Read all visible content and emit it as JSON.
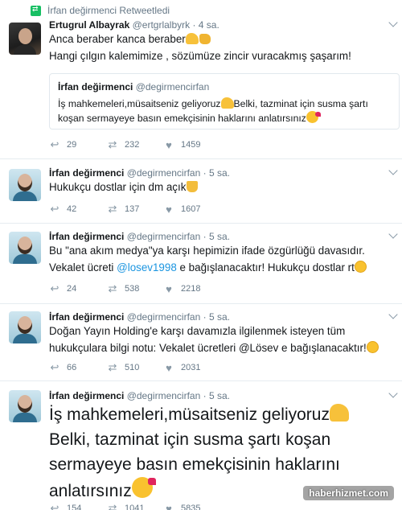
{
  "retweet_banner": {
    "text": "İrfan değirmenci Retweetledi"
  },
  "tweets": [
    {
      "name": "Ertugrul Albayrak",
      "handle": "@ertgrlalbyrk",
      "date": "· 4 sa.",
      "line1": "Anca beraber kanca beraber",
      "line2": "Hangi çılgın kalemimize , sözümüze zincir vuracakmış şaşarım!",
      "quote": {
        "name": "İrfan değirmenci",
        "handle": "@degirmencirfan",
        "text_a": "İş mahkemeleri,müsaitseniz geliyoruz",
        "text_b": "Belki, tazminat için susma şartı",
        "line2": "koşan sermayeye basın emekçisinin haklarını anlatırsınız"
      },
      "replies": "29",
      "retweets": "232",
      "likes": "1459"
    },
    {
      "name": "İrfan değirmenci",
      "handle": "@degirmencirfan",
      "date": "· 5 sa.",
      "line1": "Hukukçu dostlar için dm açık",
      "replies": "42",
      "retweets": "137",
      "likes": "1607"
    },
    {
      "name": "İrfan değirmenci",
      "handle": "@degirmencirfan",
      "date": "· 5 sa.",
      "line1": "Bu \"ana akım medya\"ya karşı hepimizin ifade özgürlüğü davasıdır.",
      "line2_a": "Vekalet ücreti ",
      "line2_link": "@losev1998",
      "line2_b": " e bağışlanacaktır! Hukukçu dostlar rt",
      "replies": "24",
      "retweets": "538",
      "likes": "2218"
    },
    {
      "name": "İrfan değirmenci",
      "handle": "@degirmencirfan",
      "date": "· 5 sa.",
      "line1": "Doğan Yayın Holding'e karşı davamızla ilgilenmek isteyen tüm",
      "line2": "hukukçulara bilgi notu: Vekalet ücretleri @Lösev e bağışlanacaktır!",
      "replies": "66",
      "retweets": "510",
      "likes": "2031"
    },
    {
      "name": "İrfan değirmenci",
      "handle": "@degirmencirfan",
      "date": "· 5 sa.",
      "line1": "İş mahkemeleri,müsaitseniz geliyoruz",
      "line2": "Belki, tazminat için susma şartı koşan",
      "line3": "sermayeye basın emekçisinin haklarını",
      "line4": "anlatırsınız",
      "replies": "154",
      "retweets": "1041",
      "likes": "5835"
    }
  ],
  "watermark": "haberhizmet.com",
  "icons": {
    "reply": "reply-icon",
    "retweet": "retweet-icon",
    "like": "heart-icon",
    "menu": "chevron-down-icon",
    "retweet_banner": "retweet-icon"
  },
  "colors": {
    "link": "#1b95e0",
    "muted": "#657786",
    "retweet_green": "#17bf63",
    "text": "#14171a"
  }
}
